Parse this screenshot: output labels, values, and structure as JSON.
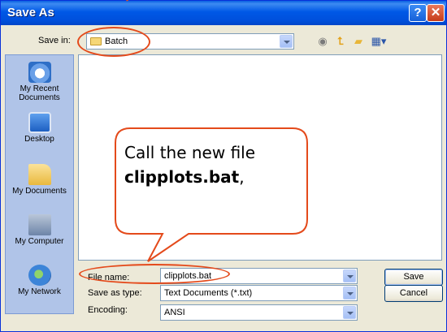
{
  "window": {
    "title": "Save As",
    "help_label": "?",
    "close_label": "✕"
  },
  "toolbar": {
    "save_in_label": "Save in:",
    "save_in_value": "Batch",
    "icons": [
      "back-icon",
      "up-folder-icon",
      "new-folder-icon",
      "views-menu-icon"
    ]
  },
  "places": [
    {
      "label": "My Recent Documents",
      "icon": "recent-documents-icon"
    },
    {
      "label": "Desktop",
      "icon": "desktop-icon"
    },
    {
      "label": "My Documents",
      "icon": "my-documents-icon"
    },
    {
      "label": "My Computer",
      "icon": "my-computer-icon"
    },
    {
      "label": "My Network",
      "icon": "my-network-icon"
    }
  ],
  "form": {
    "file_name_label": "File name:",
    "file_name_value": "clipplots.bat",
    "save_as_type_label": "Save as type:",
    "save_as_type_value": "Text Documents (*.txt)",
    "encoding_label": "Encoding:",
    "encoding_value": "ANSI"
  },
  "buttons": {
    "save": "Save",
    "cancel": "Cancel"
  },
  "callout": {
    "line1": "Call the new file",
    "bold": "clipplots.bat",
    "suffix": ","
  },
  "colors": {
    "annotation": "#e44a1b",
    "titlebar": "#0058e6"
  }
}
